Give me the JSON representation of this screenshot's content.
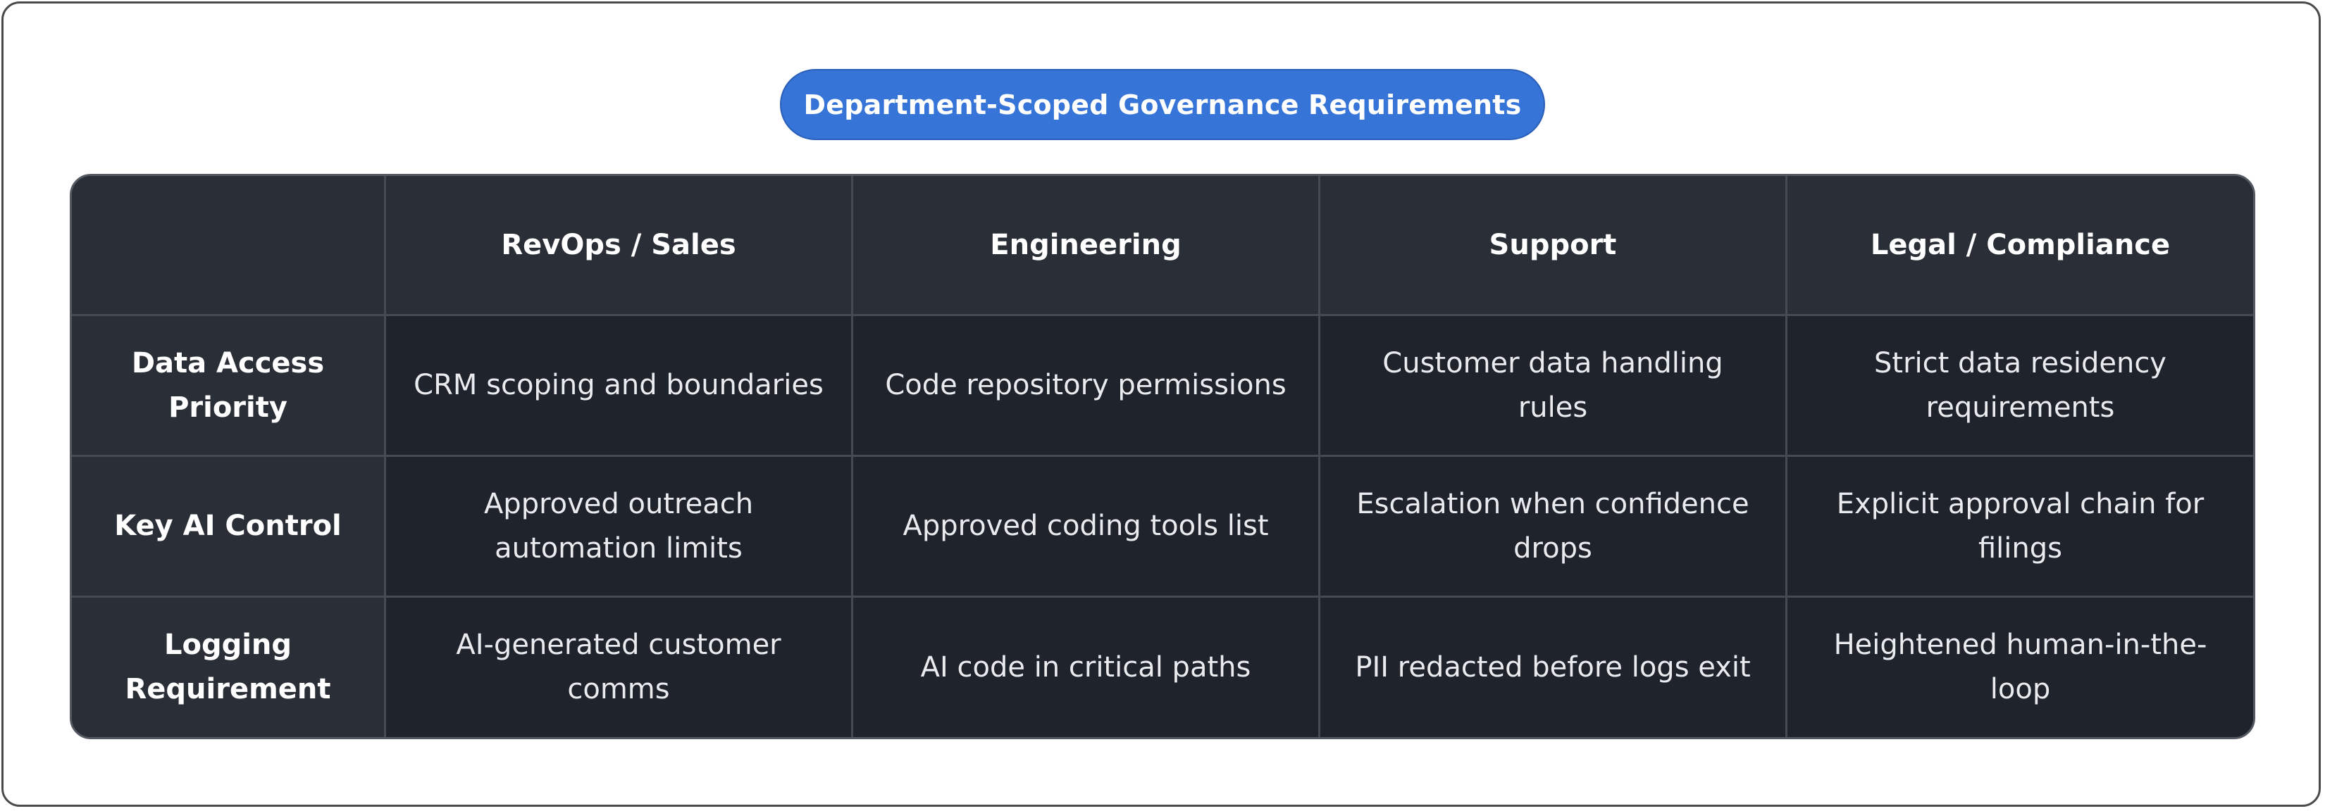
{
  "title": "Department-Scoped Governance Requirements",
  "table": {
    "corner": "",
    "columns": [
      "RevOps / Sales",
      "Engineering",
      "Support",
      "Legal / Compliance"
    ],
    "rows": [
      {
        "label": "Data Access Priority",
        "cells": [
          "CRM scoping and boundaries",
          "Code repository permissions",
          "Customer data handling rules",
          "Strict data residency requirements"
        ]
      },
      {
        "label": "Key AI Control",
        "cells": [
          "Approved outreach automation limits",
          "Approved coding tools list",
          "Escalation when confidence drops",
          "Explicit approval chain for filings"
        ]
      },
      {
        "label": "Logging Requirement",
        "cells": [
          "AI-generated customer comms",
          "AI code in critical paths",
          "PII redacted before logs exit",
          "Heightened human-in-the-loop"
        ]
      }
    ]
  },
  "colors": {
    "title_pill": "#3674d8",
    "header_bg": "#2a2e37",
    "cell_bg": "#1f232c",
    "grid_line": "#454a53",
    "text": "#e9ebef"
  }
}
